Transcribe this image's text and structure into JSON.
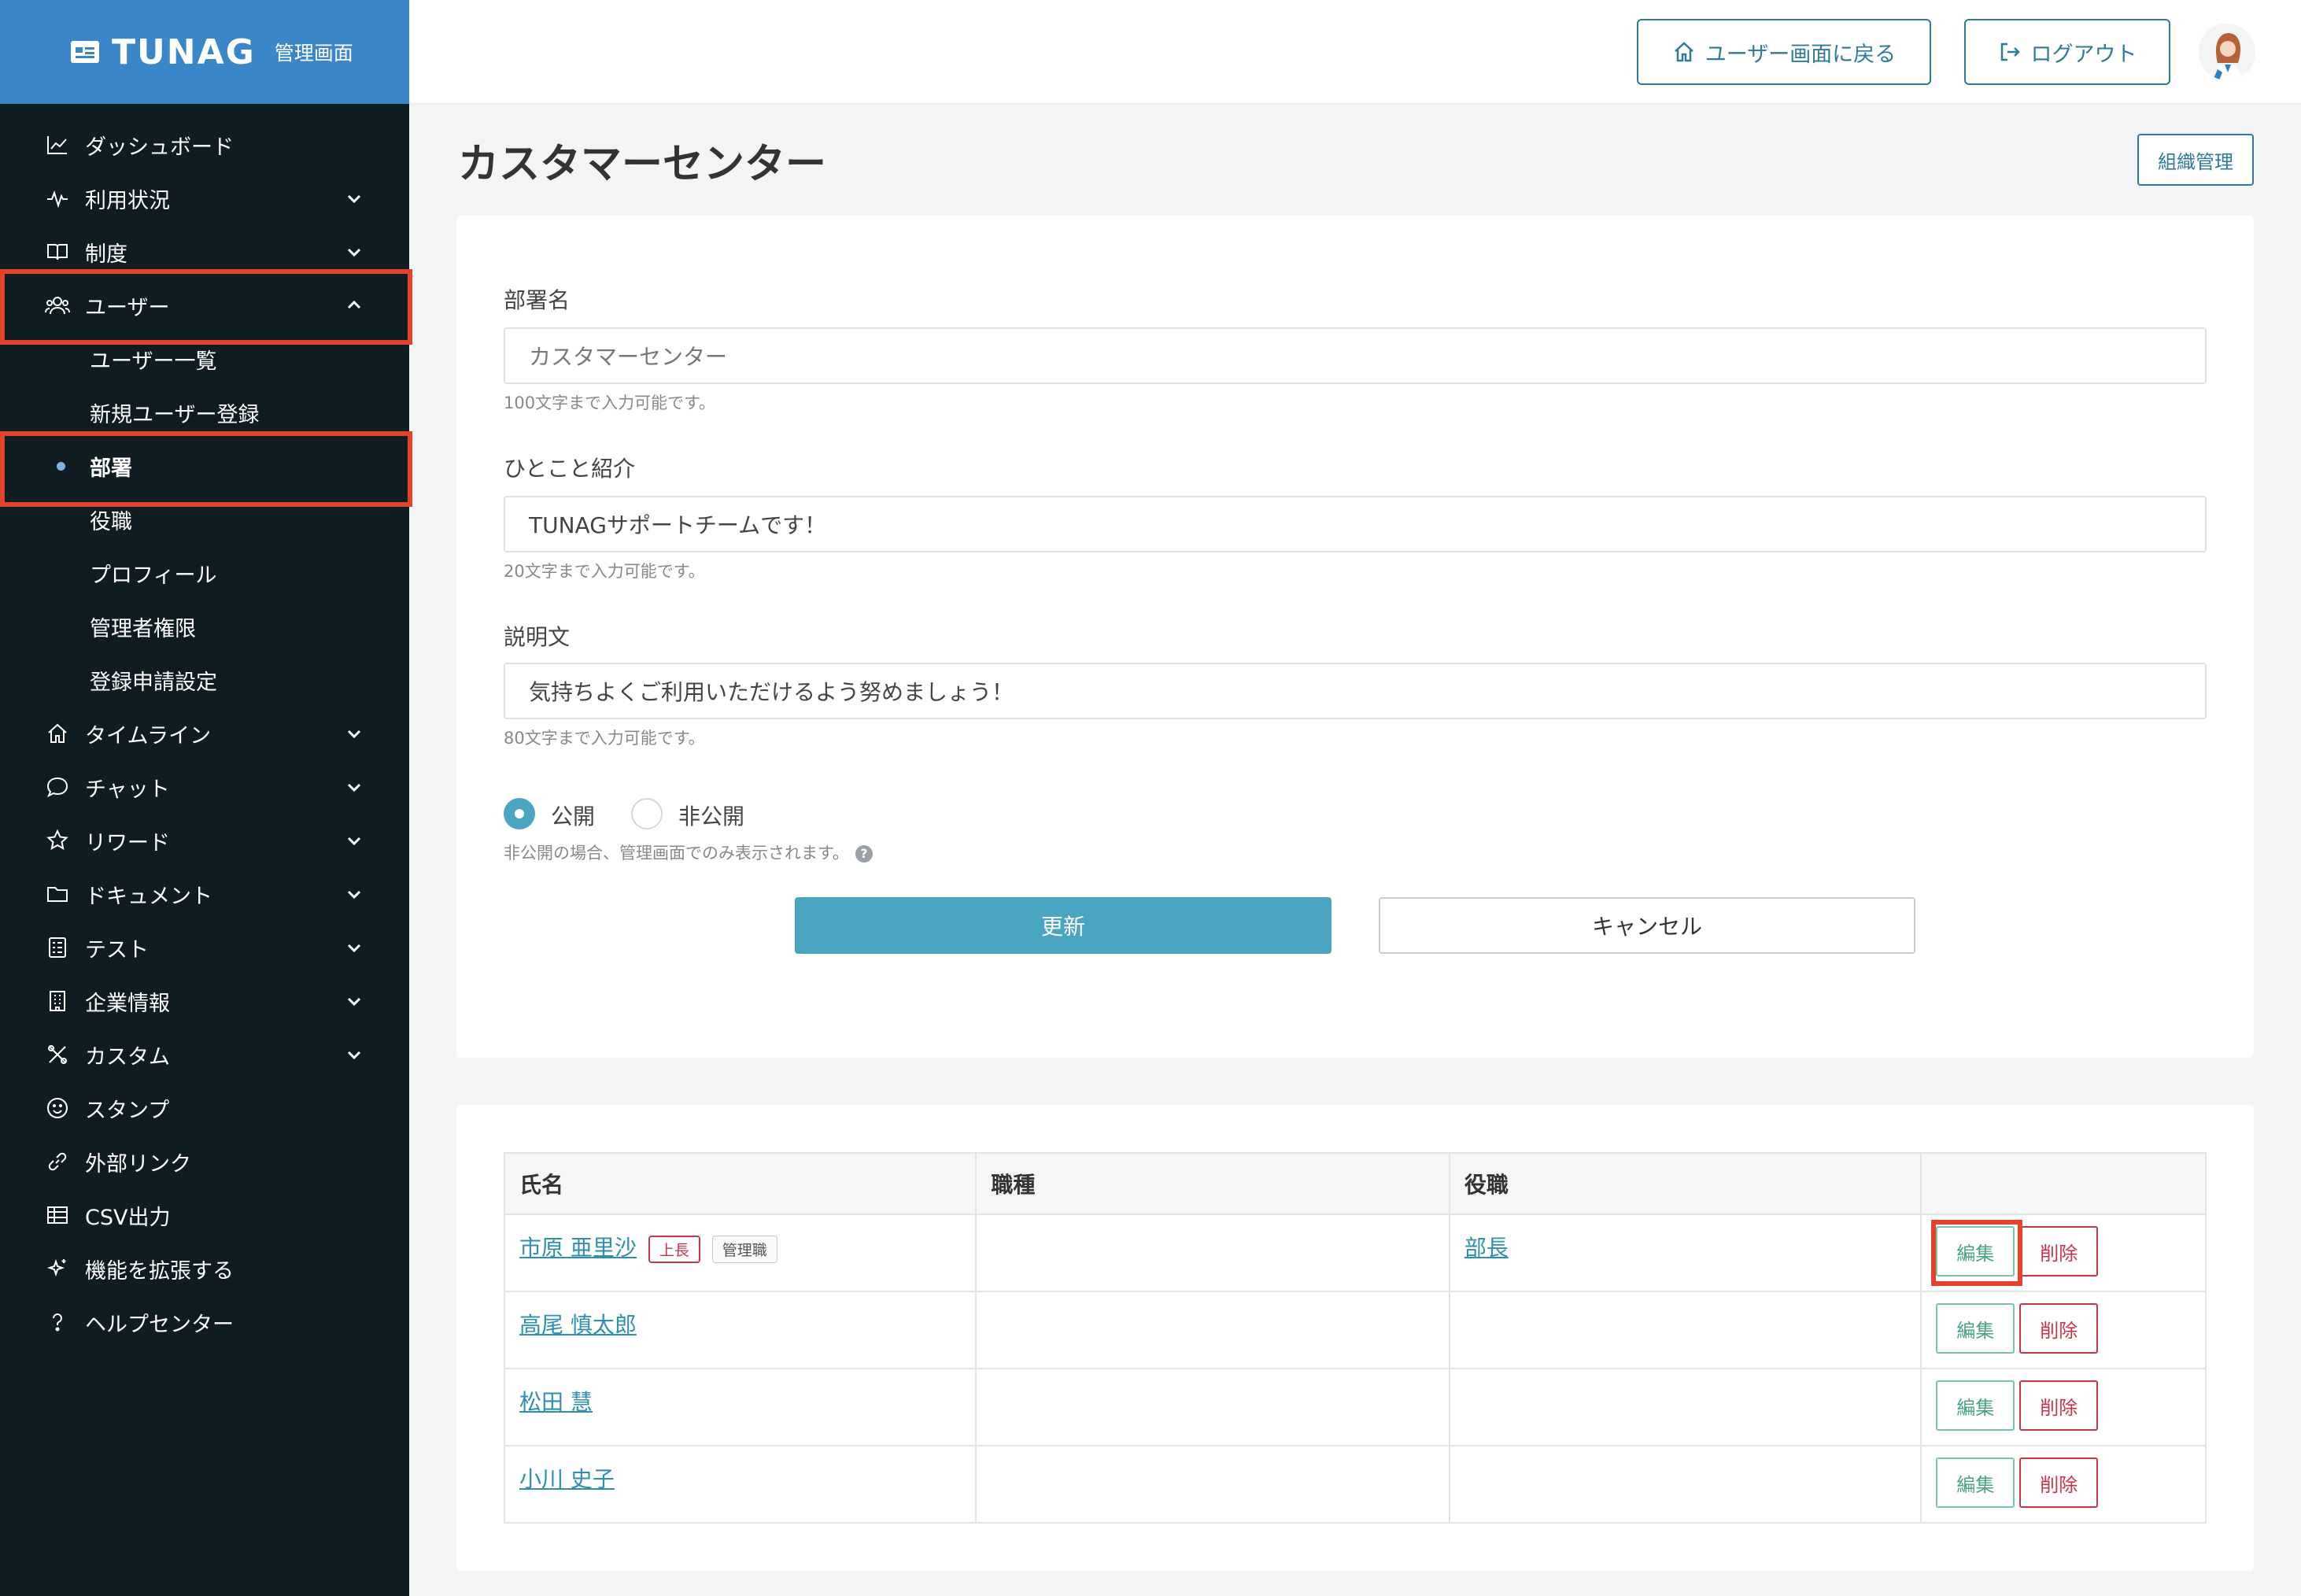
{
  "brand": {
    "name": "TUNAG",
    "sub": "管理画面"
  },
  "nav": {
    "items": [
      {
        "label": "ダッシュボード",
        "icon": "chart-line-icon",
        "chevron": false
      },
      {
        "label": "利用状況",
        "icon": "pulse-icon",
        "chevron": "down"
      },
      {
        "label": "制度",
        "icon": "book-icon",
        "chevron": "down"
      },
      {
        "label": "ユーザー",
        "icon": "users-icon",
        "chevron": "up"
      }
    ],
    "user_sub": [
      {
        "label": "ユーザー一覧"
      },
      {
        "label": "新規ユーザー登録"
      },
      {
        "label": "部署",
        "active": true
      },
      {
        "label": "役職"
      },
      {
        "label": "プロフィール"
      },
      {
        "label": "管理者権限"
      },
      {
        "label": "登録申請設定"
      }
    ],
    "items2": [
      {
        "label": "タイムライン",
        "icon": "home-icon",
        "chevron": "down"
      },
      {
        "label": "チャット",
        "icon": "chat-icon",
        "chevron": "down"
      },
      {
        "label": "リワード",
        "icon": "star-icon",
        "chevron": "down"
      },
      {
        "label": "ドキュメント",
        "icon": "folder-icon",
        "chevron": "down"
      },
      {
        "label": "テスト",
        "icon": "test-icon",
        "chevron": "down"
      },
      {
        "label": "企業情報",
        "icon": "building-icon",
        "chevron": "down"
      },
      {
        "label": "カスタム",
        "icon": "tools-icon",
        "chevron": "down"
      },
      {
        "label": "スタンプ",
        "icon": "smile-icon",
        "chevron": false
      },
      {
        "label": "外部リンク",
        "icon": "link-icon",
        "chevron": false
      },
      {
        "label": "CSV出力",
        "icon": "table-icon",
        "chevron": false
      },
      {
        "label": "機能を拡張する",
        "icon": "sparkle-icon",
        "chevron": false
      },
      {
        "label": "ヘルプセンター",
        "icon": "help-icon",
        "chevron": false
      }
    ]
  },
  "header": {
    "back_label": "ユーザー画面に戻る",
    "logout_label": "ログアウト"
  },
  "page": {
    "title": "カスタマーセンター",
    "org_button": "組織管理"
  },
  "form": {
    "dept_label": "部署名",
    "dept_value": "カスタマーセンター",
    "dept_hint": "100文字まで入力可能です。",
    "intro_label": "ひとこと紹介",
    "intro_value": "TUNAGサポートチームです！",
    "intro_hint": "20文字まで入力可能です。",
    "desc_label": "説明文",
    "desc_value": "気持ちよくご利用いただけるよう努めましょう！",
    "desc_hint": "80文字まで入力可能です。",
    "public_label": "公開",
    "private_label": "非公開",
    "visibility": "公開",
    "visibility_hint": "非公開の場合、管理画面でのみ表示されます。",
    "update_label": "更新",
    "cancel_label": "キャンセル"
  },
  "table": {
    "headers": [
      "氏名",
      "職種",
      "役職",
      ""
    ],
    "rows": [
      {
        "name": "市原 亜里沙",
        "badges": [
          "上長",
          "管理職"
        ],
        "job": "",
        "position": "部長"
      },
      {
        "name": "高尾 慎太郎",
        "badges": [],
        "job": "",
        "position": ""
      },
      {
        "name": "松田 慧",
        "badges": [],
        "job": "",
        "position": ""
      },
      {
        "name": "小川 史子",
        "badges": [],
        "job": "",
        "position": ""
      }
    ],
    "edit_label": "編集",
    "delete_label": "削除"
  },
  "colors": {
    "sidebar_bg": "#0f1d23",
    "brand_bg": "#3a86c8",
    "accent": "#4aa6c0",
    "highlight": "#e2432a"
  }
}
